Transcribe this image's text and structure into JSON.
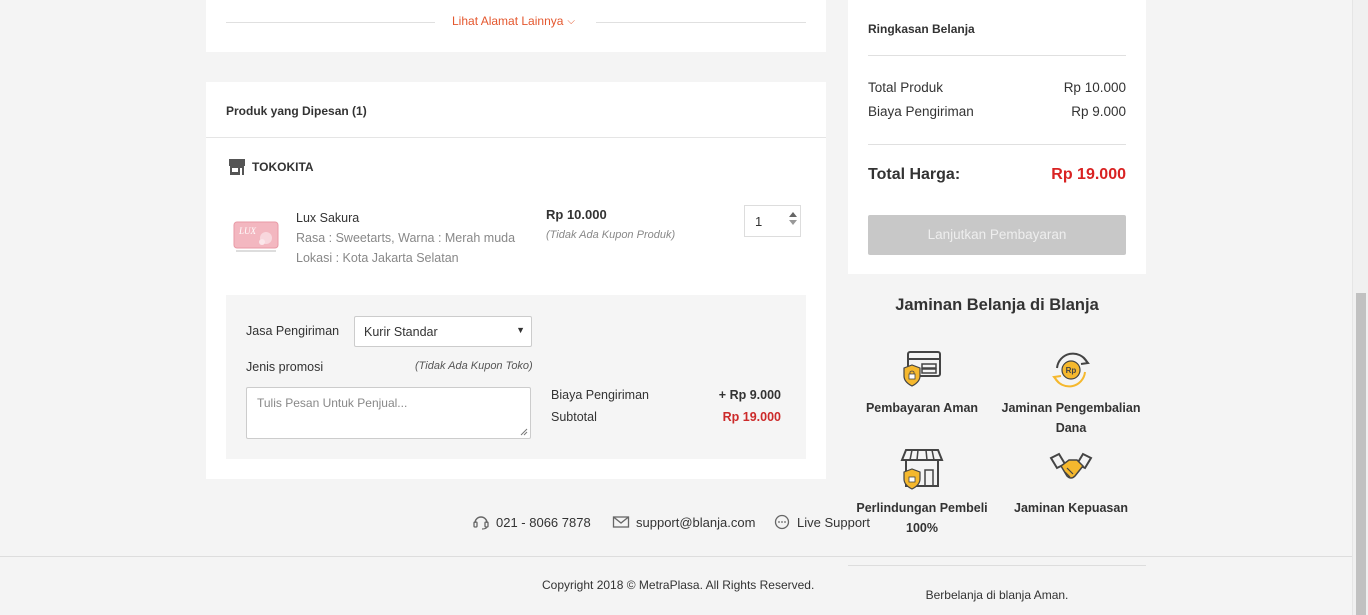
{
  "address": {
    "see_more": "Lihat Alamat Lainnya"
  },
  "order": {
    "header": "Produk yang Dipesan (1)",
    "store_name": "TOKOKITA",
    "product": {
      "name": "Lux Sakura",
      "variant": "Rasa : Sweetarts, Warna : Merah muda",
      "location": "Lokasi : Kota Jakarta Selatan",
      "price": "Rp 10.000",
      "coupon": "(Tidak Ada Kupon Produk)",
      "quantity": "1",
      "image_brand": "LUX"
    },
    "shipping": {
      "label": "Jasa Pengiriman",
      "selected": "Kurir Standar",
      "promo_label": "Jenis promosi",
      "promo_none": "(Tidak Ada Kupon Toko)",
      "note_placeholder": "Tulis Pesan Untuk Penjual...",
      "fee_label": "Biaya Pengiriman",
      "fee_value": "+ Rp 9.000",
      "subtotal_label": "Subtotal",
      "subtotal_value": "Rp 19.000"
    }
  },
  "summary": {
    "title": "Ringkasan Belanja",
    "total_products_label": "Total Produk",
    "total_products_value": "Rp 10.000",
    "shipping_label": "Biaya Pengiriman",
    "shipping_value": "Rp 9.000",
    "total_label": "Total Harga:",
    "total_value": "Rp 19.000",
    "pay_button": "Lanjutkan Pembayaran"
  },
  "guarantee": {
    "title": "Jaminan Belanja di Blanja",
    "items": [
      {
        "label": "Pembayaran Aman",
        "icon": "card-shield-icon"
      },
      {
        "label": "Jaminan Pengembalian Dana",
        "icon": "refund-icon"
      },
      {
        "label": "Perlindungan Pembeli 100%",
        "icon": "store-shield-icon"
      },
      {
        "label": "Jaminan Kepuasan",
        "icon": "handshake-icon"
      }
    ],
    "refund_badge": "Rp"
  },
  "contact": {
    "phone": "021 - 8066 7878",
    "email": "support@blanja.com",
    "live": "Live Support"
  },
  "footer": {
    "copyright": "Copyright 2018 © MetraPlasa. All Rights Reserved.",
    "tagline": "Berbelanja di blanja Aman."
  },
  "colors": {
    "accent_orange": "#e4572e",
    "price_red": "#d92222",
    "icon_yellow": "#f5b82e"
  }
}
